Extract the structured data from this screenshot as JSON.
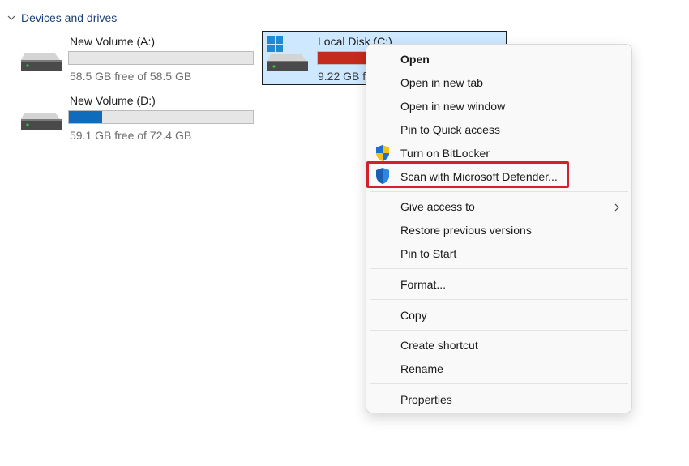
{
  "section": {
    "title": "Devices and drives"
  },
  "drives": [
    {
      "name": "New Volume (A:)",
      "free_text": "58.5 GB free of 58.5 GB",
      "used_fraction": 0.0,
      "bar_color": "#0f6cbd"
    },
    {
      "name": "New Volume (D:)",
      "free_text": "59.1 GB free of 72.4 GB",
      "used_fraction": 0.18,
      "bar_color": "#0f6cbd"
    },
    {
      "name": "Local Disk (C:)",
      "free_text": "9.22 GB f",
      "used_fraction": 0.95,
      "bar_color": "#c42b1c"
    }
  ],
  "context_menu": {
    "items": [
      {
        "label": "Open",
        "bold": true
      },
      {
        "label": "Open in new tab"
      },
      {
        "label": "Open in new window"
      },
      {
        "label": "Pin to Quick access"
      },
      {
        "label": "Turn on BitLocker",
        "icon": "bitlocker-shield-icon"
      },
      {
        "label": "Scan with Microsoft Defender...",
        "icon": "defender-shield-icon"
      },
      {
        "label": "Give access to",
        "has_submenu": true
      },
      {
        "label": "Restore previous versions"
      },
      {
        "label": "Pin to Start"
      },
      {
        "label": "Format..."
      },
      {
        "label": "Copy"
      },
      {
        "label": "Create shortcut"
      },
      {
        "label": "Rename"
      },
      {
        "label": "Properties"
      }
    ]
  },
  "colors": {
    "selection_bg": "#cde8ff",
    "highlight_box": "#d2202c",
    "section_header": "#1c3f72"
  }
}
